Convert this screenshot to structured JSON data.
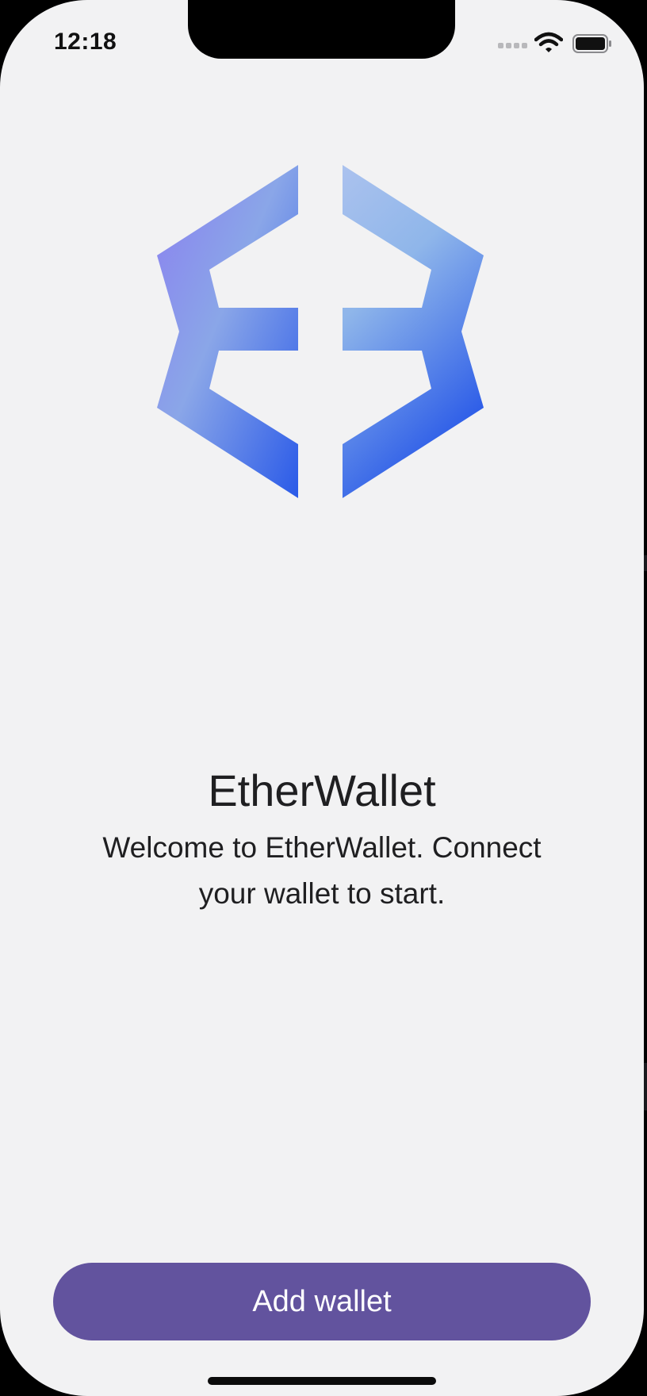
{
  "status_bar": {
    "time": "12:18"
  },
  "app": {
    "name": "EtherWallet",
    "welcome": "Welcome to EtherWallet. Connect your wallet to start."
  },
  "actions": {
    "add_wallet_label": "Add wallet"
  },
  "icons": {
    "signal": "cellular-signal-icon",
    "wifi": "wifi-icon",
    "battery": "battery-icon",
    "logo": "exodus-logo-icon"
  },
  "colors": {
    "background": "#f2f2f3",
    "button": "#62539e",
    "button_text": "#ffffff",
    "text": "#1f1f21",
    "logo_top_left": "#8b7ff0",
    "logo_top_right": "#a9c4ee",
    "logo_bottom": "#2a5ae8"
  }
}
